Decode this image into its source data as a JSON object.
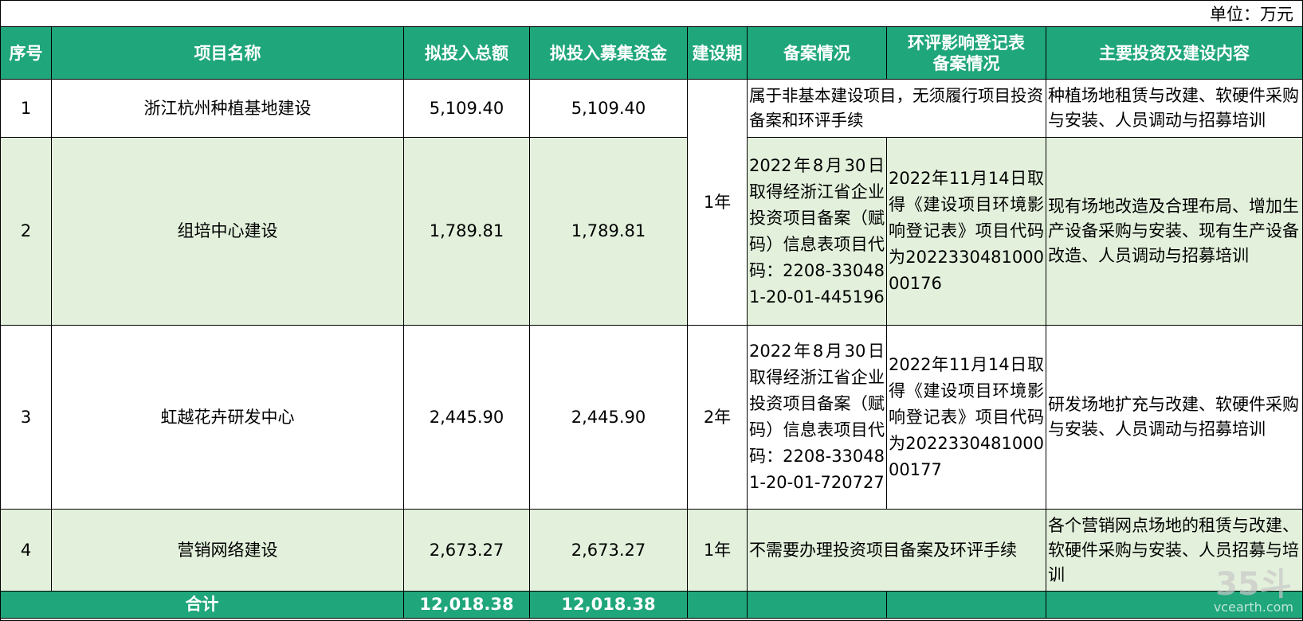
{
  "unit": "单位：万元",
  "headers": {
    "seq": "序号",
    "name": "项目名称",
    "total": "拟投入总额",
    "raised": "拟投入募集资金",
    "period": "建设期",
    "filing": "备案情况",
    "env": "环评影响登记表备案情况",
    "content": "主要投资及建设内容"
  },
  "rows": [
    {
      "seq": "1",
      "name": "浙江杭州种植基地建设",
      "total": "5,109.40",
      "raised": "5,109.40",
      "filing_merged": "属于非基本建设项目，无须履行项目投资备案和环评手续",
      "content": "种植场地租赁与改建、软硬件采购与安装、人员调动与招募培训"
    },
    {
      "seq": "2",
      "name": "组培中心建设",
      "total": "1,789.81",
      "raised": "1,789.81",
      "filing": "2022年8月30日取得经浙江省企业投资项目备案（赋码）信息表项目代码：2208-330481-20-01-445196",
      "env": "2022年11月14日取得《建设项目环境影响登记表》项目代码为202233048100000176",
      "content": "现有场地改造及合理布局、增加生产设备采购与安装、现有生产设备改造、人员调动与招募培训"
    },
    {
      "seq": "3",
      "name": "虹越花卉研发中心",
      "total": "2,445.90",
      "raised": "2,445.90",
      "period": "2年",
      "filing": "2022年8月30日取得经浙江省企业投资项目备案（赋码）信息表项目代码：2208-330481-20-01-720727",
      "env": "2022年11月14日取得《建设项目环境影响登记表》项目代码为202233048100000177",
      "content": "研发场地扩充与改建、软硬件采购与安装、人员调动与招募培训"
    },
    {
      "seq": "4",
      "name": "营销网络建设",
      "total": "2,673.27",
      "raised": "2,673.27",
      "period": "1年",
      "filing_merged": "不需要办理投资项目备案及环评手续",
      "content": "各个营销网点场地的租赁与改建、软硬件采购与安装、人员招募与培训"
    }
  ],
  "period_merged_1_2": "1年",
  "total_row": {
    "label": "合计",
    "total": "12,018.38",
    "raised": "12,018.38"
  },
  "watermark": {
    "logo": "35斗",
    "site": "vcearth.com"
  }
}
